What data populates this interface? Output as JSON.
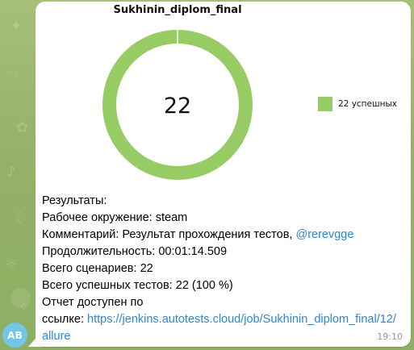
{
  "chat": {
    "avatar_initials": "AB",
    "time": "19:10"
  },
  "chart_data": {
    "type": "pie",
    "title": "Sukhinin_diplom_final",
    "center_label": "22",
    "total": 22,
    "slices": [
      {
        "label": "22 успешных",
        "value": 22,
        "color": "#97cc64"
      }
    ]
  },
  "message": {
    "results_label": "Результаты:",
    "environment_label": "Рабочее окружение:",
    "environment_value": "steam",
    "comment_label": "Комментарий:",
    "comment_value": "Результат прохождения тестов,",
    "comment_mention": "@rerevgge",
    "duration_label": "Продолжительность:",
    "duration_value": "00:01:14.509",
    "scenarios_label": "Всего сценариев:",
    "scenarios_value": "22",
    "success_label": "Всего успешных тестов:",
    "success_value": "22 (100 %)",
    "report_label_1": "Отчет доступен по",
    "report_label_2": "ссылке:",
    "report_url": "https://jenkins.autotests.cloud/job/Sukhinin_diplom_final/12/allure"
  }
}
